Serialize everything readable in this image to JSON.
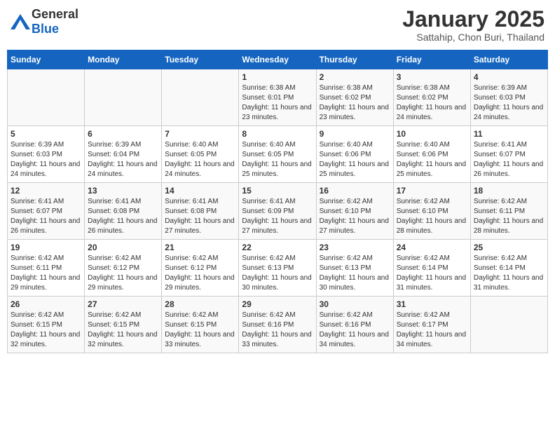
{
  "header": {
    "logo_general": "General",
    "logo_blue": "Blue",
    "month_title": "January 2025",
    "location": "Sattahip, Chon Buri, Thailand"
  },
  "weekdays": [
    "Sunday",
    "Monday",
    "Tuesday",
    "Wednesday",
    "Thursday",
    "Friday",
    "Saturday"
  ],
  "weeks": [
    [
      {
        "day": "",
        "info": ""
      },
      {
        "day": "",
        "info": ""
      },
      {
        "day": "",
        "info": ""
      },
      {
        "day": "1",
        "info": "Sunrise: 6:38 AM\nSunset: 6:01 PM\nDaylight: 11 hours and 23 minutes."
      },
      {
        "day": "2",
        "info": "Sunrise: 6:38 AM\nSunset: 6:02 PM\nDaylight: 11 hours and 23 minutes."
      },
      {
        "day": "3",
        "info": "Sunrise: 6:38 AM\nSunset: 6:02 PM\nDaylight: 11 hours and 24 minutes."
      },
      {
        "day": "4",
        "info": "Sunrise: 6:39 AM\nSunset: 6:03 PM\nDaylight: 11 hours and 24 minutes."
      }
    ],
    [
      {
        "day": "5",
        "info": "Sunrise: 6:39 AM\nSunset: 6:03 PM\nDaylight: 11 hours and 24 minutes."
      },
      {
        "day": "6",
        "info": "Sunrise: 6:39 AM\nSunset: 6:04 PM\nDaylight: 11 hours and 24 minutes."
      },
      {
        "day": "7",
        "info": "Sunrise: 6:40 AM\nSunset: 6:05 PM\nDaylight: 11 hours and 24 minutes."
      },
      {
        "day": "8",
        "info": "Sunrise: 6:40 AM\nSunset: 6:05 PM\nDaylight: 11 hours and 25 minutes."
      },
      {
        "day": "9",
        "info": "Sunrise: 6:40 AM\nSunset: 6:06 PM\nDaylight: 11 hours and 25 minutes."
      },
      {
        "day": "10",
        "info": "Sunrise: 6:40 AM\nSunset: 6:06 PM\nDaylight: 11 hours and 25 minutes."
      },
      {
        "day": "11",
        "info": "Sunrise: 6:41 AM\nSunset: 6:07 PM\nDaylight: 11 hours and 26 minutes."
      }
    ],
    [
      {
        "day": "12",
        "info": "Sunrise: 6:41 AM\nSunset: 6:07 PM\nDaylight: 11 hours and 26 minutes."
      },
      {
        "day": "13",
        "info": "Sunrise: 6:41 AM\nSunset: 6:08 PM\nDaylight: 11 hours and 26 minutes."
      },
      {
        "day": "14",
        "info": "Sunrise: 6:41 AM\nSunset: 6:08 PM\nDaylight: 11 hours and 27 minutes."
      },
      {
        "day": "15",
        "info": "Sunrise: 6:41 AM\nSunset: 6:09 PM\nDaylight: 11 hours and 27 minutes."
      },
      {
        "day": "16",
        "info": "Sunrise: 6:42 AM\nSunset: 6:10 PM\nDaylight: 11 hours and 27 minutes."
      },
      {
        "day": "17",
        "info": "Sunrise: 6:42 AM\nSunset: 6:10 PM\nDaylight: 11 hours and 28 minutes."
      },
      {
        "day": "18",
        "info": "Sunrise: 6:42 AM\nSunset: 6:11 PM\nDaylight: 11 hours and 28 minutes."
      }
    ],
    [
      {
        "day": "19",
        "info": "Sunrise: 6:42 AM\nSunset: 6:11 PM\nDaylight: 11 hours and 29 minutes."
      },
      {
        "day": "20",
        "info": "Sunrise: 6:42 AM\nSunset: 6:12 PM\nDaylight: 11 hours and 29 minutes."
      },
      {
        "day": "21",
        "info": "Sunrise: 6:42 AM\nSunset: 6:12 PM\nDaylight: 11 hours and 29 minutes."
      },
      {
        "day": "22",
        "info": "Sunrise: 6:42 AM\nSunset: 6:13 PM\nDaylight: 11 hours and 30 minutes."
      },
      {
        "day": "23",
        "info": "Sunrise: 6:42 AM\nSunset: 6:13 PM\nDaylight: 11 hours and 30 minutes."
      },
      {
        "day": "24",
        "info": "Sunrise: 6:42 AM\nSunset: 6:14 PM\nDaylight: 11 hours and 31 minutes."
      },
      {
        "day": "25",
        "info": "Sunrise: 6:42 AM\nSunset: 6:14 PM\nDaylight: 11 hours and 31 minutes."
      }
    ],
    [
      {
        "day": "26",
        "info": "Sunrise: 6:42 AM\nSunset: 6:15 PM\nDaylight: 11 hours and 32 minutes."
      },
      {
        "day": "27",
        "info": "Sunrise: 6:42 AM\nSunset: 6:15 PM\nDaylight: 11 hours and 32 minutes."
      },
      {
        "day": "28",
        "info": "Sunrise: 6:42 AM\nSunset: 6:15 PM\nDaylight: 11 hours and 33 minutes."
      },
      {
        "day": "29",
        "info": "Sunrise: 6:42 AM\nSunset: 6:16 PM\nDaylight: 11 hours and 33 minutes."
      },
      {
        "day": "30",
        "info": "Sunrise: 6:42 AM\nSunset: 6:16 PM\nDaylight: 11 hours and 34 minutes."
      },
      {
        "day": "31",
        "info": "Sunrise: 6:42 AM\nSunset: 6:17 PM\nDaylight: 11 hours and 34 minutes."
      },
      {
        "day": "",
        "info": ""
      }
    ]
  ]
}
